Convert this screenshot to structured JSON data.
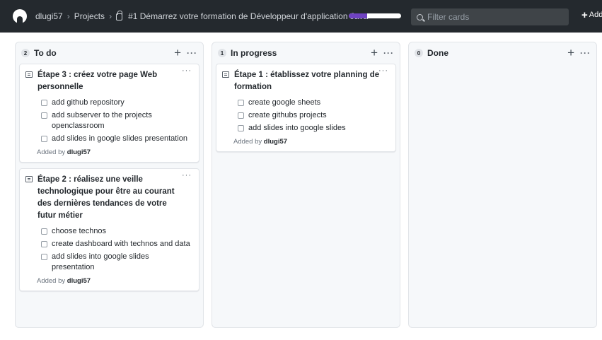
{
  "header": {
    "user": "dlugi57",
    "projects": "Projects",
    "project_title": "#1 Démarrez votre formation de Développeur d'application Java",
    "progress": 0.35,
    "filter_placeholder": "Filter cards",
    "add_label": "Add",
    "accent": "#6f42c1"
  },
  "columns": [
    {
      "count": "2",
      "title": "To do",
      "add": "+",
      "more": "···",
      "cards": [
        {
          "title": "Étape 3 : créez votre page Web personnelle",
          "more": "···",
          "tasks": [
            "add github repository",
            "add subserver to the projects openclassroom",
            "add slides in google slides presentation"
          ],
          "added_prefix": "Added by",
          "added_by": "dlugi57"
        },
        {
          "title": "Étape 2 : réalisez une veille technologique pour être au courant des dernières tendances de votre futur métier",
          "more": "···",
          "tasks": [
            "choose technos",
            "create dashboard with technos and data",
            "add slides into google slides presentation"
          ],
          "added_prefix": "Added by",
          "added_by": "dlugi57"
        }
      ]
    },
    {
      "count": "1",
      "title": "In progress",
      "add": "+",
      "more": "···",
      "cards": [
        {
          "title": "Étape 1 : établissez votre planning de formation",
          "more": "···",
          "tasks": [
            "create google sheets",
            "create githubs projects",
            "add slides into google slides"
          ],
          "added_prefix": "Added by",
          "added_by": "dlugi57"
        }
      ]
    },
    {
      "count": "0",
      "title": "Done",
      "add": "+",
      "more": "···",
      "cards": []
    }
  ]
}
